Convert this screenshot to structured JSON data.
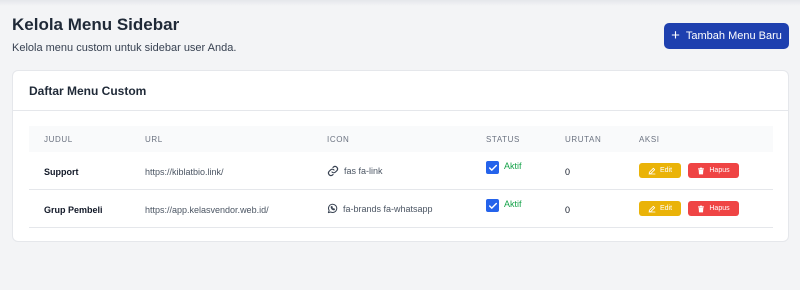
{
  "header": {
    "title": "Kelola Menu Sidebar",
    "subtitle": "Kelola menu custom untuk sidebar user Anda.",
    "add_button_label": "Tambah Menu Baru"
  },
  "card": {
    "title": "Daftar Menu Custom"
  },
  "table": {
    "columns": {
      "judul": "JUDUL",
      "url": "URL",
      "icon": "ICON",
      "status": "STATUS",
      "urutan": "URUTAN",
      "aksi": "AKSI"
    },
    "rows": [
      {
        "judul": "Support",
        "url": "https://kiblatbio.link/",
        "icon_name": "link-icon",
        "icon": "fas fa-link",
        "status_checked": true,
        "status": "Aktif",
        "urutan": "0",
        "edit_label": "Edit",
        "delete_label": "Hapus"
      },
      {
        "judul": "Grup Pembeli",
        "url": "https://app.kelasvendor.web.id/",
        "icon_name": "whatsapp-icon",
        "icon": "fa-brands fa-whatsapp",
        "status_checked": true,
        "status": "Aktif",
        "urutan": "0",
        "edit_label": "Edit",
        "delete_label": "Hapus"
      }
    ]
  },
  "colors": {
    "primary": "#1e40af",
    "checkbox": "#2563eb",
    "status_active": "#16a34a",
    "edit": "#eab308",
    "delete": "#ef4444"
  }
}
